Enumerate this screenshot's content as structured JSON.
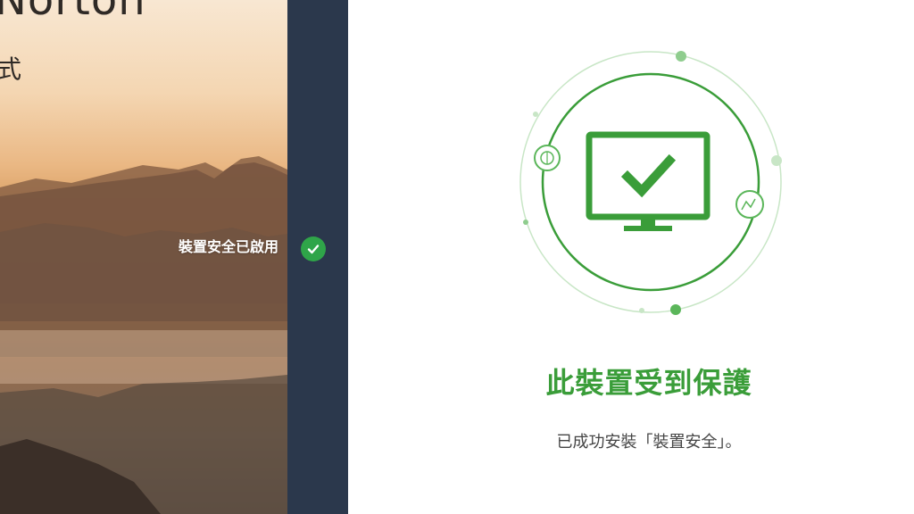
{
  "brand": {
    "name": "Norton",
    "subtitle": "式"
  },
  "steps": [
    {
      "label": "裝置安全已啟用",
      "status": "complete",
      "status_icon": "check-icon"
    }
  ],
  "illustration": {
    "icon": "monitor-check-icon",
    "accent_color": "#3a9d39"
  },
  "result": {
    "title": "此裝置受到保護",
    "message": "已成功安裝「裝置安全」。"
  },
  "colors": {
    "accent": "#3a9d39",
    "stepbar": "#2b384c",
    "check": "#2fa549"
  }
}
